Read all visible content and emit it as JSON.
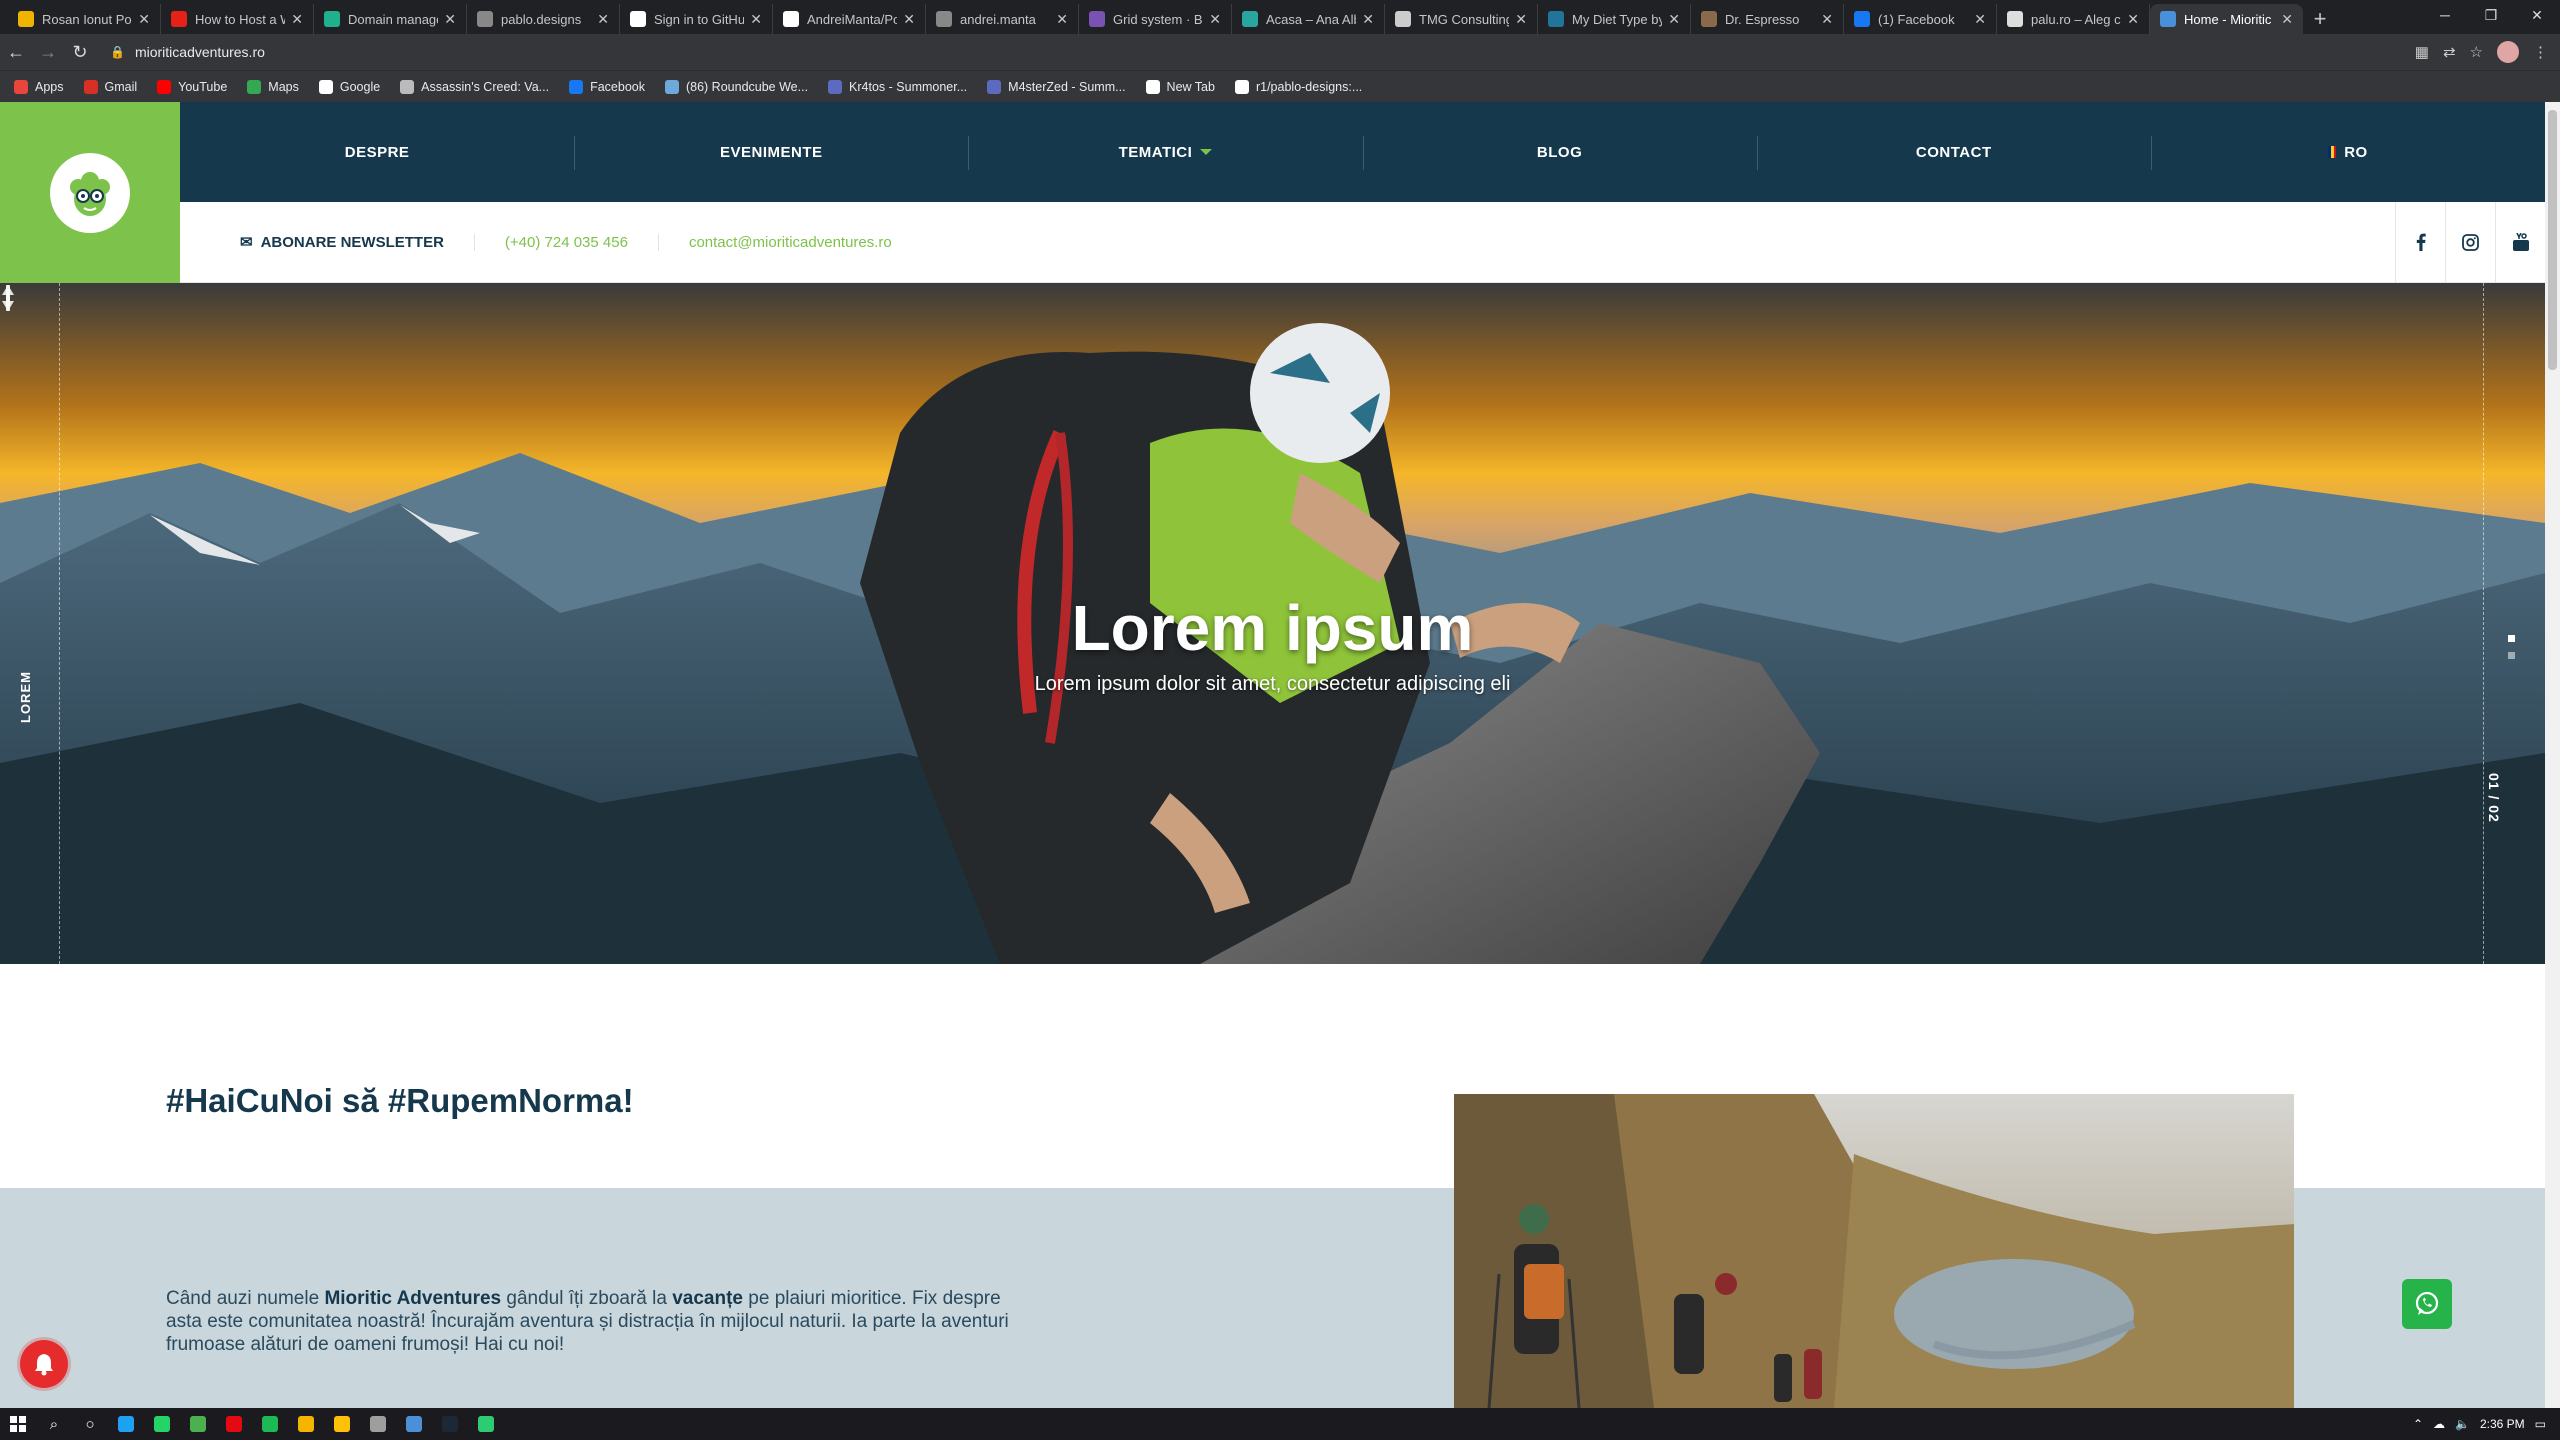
{
  "browser": {
    "tabs": [
      {
        "title": "Rosan Ionut Portf",
        "color": "#f0b400"
      },
      {
        "title": "How to Host a W",
        "color": "#e62117"
      },
      {
        "title": "Domain manage",
        "color": "#20b08d"
      },
      {
        "title": "pablo.designs",
        "color": "#888888"
      },
      {
        "title": "Sign in to GitHub",
        "color": "#ffffff"
      },
      {
        "title": "AndreiManta/Po",
        "color": "#ffffff"
      },
      {
        "title": "andrei.manta",
        "color": "#888888"
      },
      {
        "title": "Grid system · Bo",
        "color": "#7952b3"
      },
      {
        "title": "Acasa – Ana Albu",
        "color": "#2aa6a0"
      },
      {
        "title": "TMG Consulting",
        "color": "#cccccc"
      },
      {
        "title": "My Diet Type by",
        "color": "#21759b"
      },
      {
        "title": "Dr. Espresso",
        "color": "#8a6a4a"
      },
      {
        "title": "(1) Facebook",
        "color": "#1877f2"
      },
      {
        "title": "palu.ro – Aleg co",
        "color": "#dddddd"
      },
      {
        "title": "Home - Mioritic",
        "color": "#4a90d9",
        "active": true
      }
    ],
    "url": "mioriticadventures.ro",
    "bookmarks": [
      {
        "label": "Apps",
        "color": "#e8453c"
      },
      {
        "label": "Gmail",
        "color": "#d93025"
      },
      {
        "label": "YouTube",
        "color": "#ff0000"
      },
      {
        "label": "Maps",
        "color": "#34a853"
      },
      {
        "label": "Google",
        "color": "#ffffff"
      },
      {
        "label": "Assassin's Creed: Va...",
        "color": "#bbbbbb"
      },
      {
        "label": "Facebook",
        "color": "#1877f2"
      },
      {
        "label": "(86) Roundcube We...",
        "color": "#6fa8dc"
      },
      {
        "label": "Kr4tos - Summoner...",
        "color": "#5c6bc0"
      },
      {
        "label": "M4sterZed - Summ...",
        "color": "#5c6bc0"
      },
      {
        "label": "New Tab",
        "color": "#ffffff"
      },
      {
        "label": "r1/pablo-designs:...",
        "color": "#ffffff"
      }
    ]
  },
  "site": {
    "nav": {
      "items": [
        "DESPRE",
        "EVENIMENTE",
        "TEMATICI",
        "BLOG",
        "CONTACT",
        "RO"
      ]
    },
    "subbar": {
      "newsletter": "ABONARE NEWSLETTER",
      "phone": "(+40) 724 035 456",
      "email": "contact@mioriticadventures.ro"
    },
    "hero": {
      "side_label": "LOREM",
      "title": "Lorem ipsum",
      "subtitle": "Lorem ipsum dolor sit amet, consectetur adipiscing eli",
      "counter": "01 / 02"
    },
    "intro": {
      "title": "#HaiCuNoi să #RupemNorma!",
      "text_1": "Când auzi numele ",
      "brand": "Mioritic Adventures",
      "text_2": " gândul îți zboară la ",
      "vacation": "vacanțe",
      "text_3": " pe plaiuri mioritice. Fix despre asta este comunitatea noastră! Încurajăm aventura și distracția în mijlocul naturii. Ia parte la aventuri frumoase alături de oameni frumoși! Hai cu noi!"
    },
    "colors": {
      "primary": "#15384d",
      "accent": "#7dc24a",
      "band": "#c9d6dc",
      "whatsapp": "#25b34a"
    }
  },
  "taskbar": {
    "time": "2:36 PM",
    "apps": [
      "#1da1f2",
      "#25d366",
      "#4caf50",
      "#e50914",
      "#1db954",
      "#f4b400",
      "#ffc107",
      "#9e9e9e",
      "#4a90d9",
      "#1b2838",
      "#2ecc71"
    ]
  }
}
